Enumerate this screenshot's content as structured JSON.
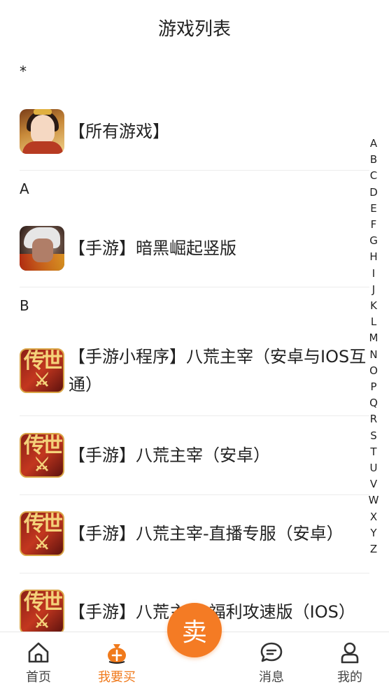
{
  "header": {
    "title": "游戏列表"
  },
  "sections": [
    {
      "letter": "*",
      "games": [
        {
          "title": "【所有游戏】",
          "icon": "all-games-icon"
        }
      ]
    },
    {
      "letter": "A",
      "games": [
        {
          "title": "【手游】暗黑崛起竖版",
          "icon": "dark-rise-icon"
        }
      ]
    },
    {
      "letter": "B",
      "games": [
        {
          "title": "【手游小程序】八荒主宰（安卓与IOS互通）",
          "icon": "bahuang-icon"
        },
        {
          "title": "【手游】八荒主宰（安卓）",
          "icon": "bahuang-icon"
        },
        {
          "title": "【手游】八荒主宰-直播专服（安卓）",
          "icon": "bahuang-icon"
        },
        {
          "title": "【手游】八荒主宰-福利攻速版（IOS）",
          "icon": "bahuang-icon"
        }
      ]
    }
  ],
  "index_letters": [
    "A",
    "B",
    "C",
    "D",
    "E",
    "F",
    "G",
    "H",
    "I",
    "J",
    "K",
    "L",
    "M",
    "N",
    "O",
    "P",
    "Q",
    "R",
    "S",
    "T",
    "U",
    "V",
    "W",
    "X",
    "Y",
    "Z"
  ],
  "tabbar": {
    "home_label": "首页",
    "buy_label": "我要买",
    "sell_label": "卖",
    "messages_label": "消息",
    "mine_label": "我的",
    "active_tab": "buy"
  },
  "colors": {
    "accent": "#f47b24",
    "active_tab_text": "#f07a1c"
  }
}
